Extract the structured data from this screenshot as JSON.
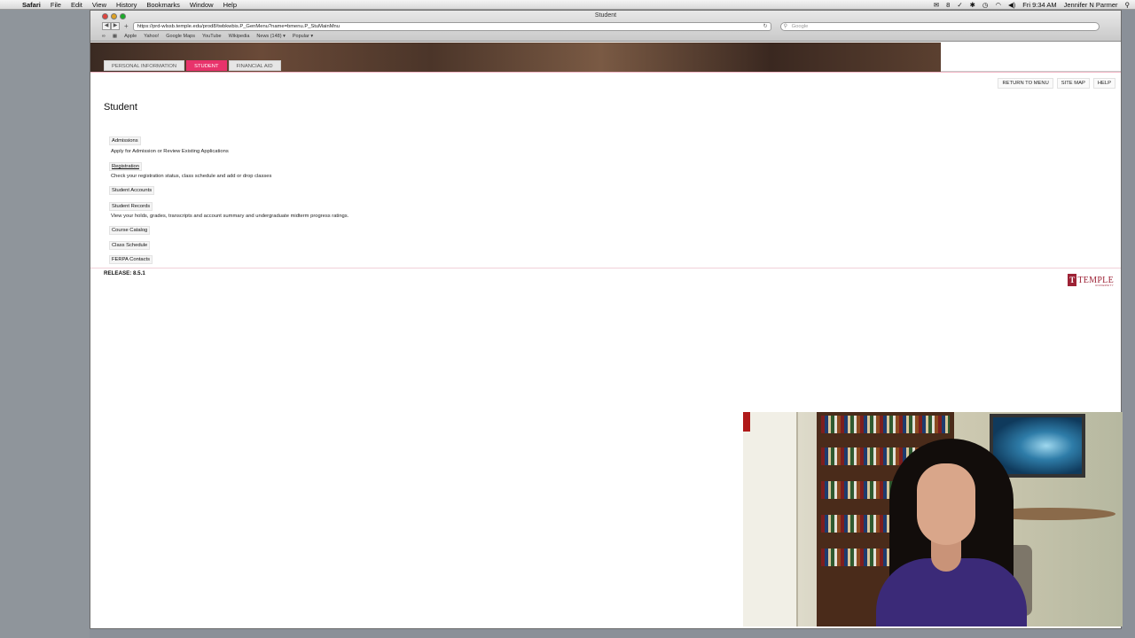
{
  "menubar": {
    "app": "Safari",
    "items": [
      "File",
      "Edit",
      "View",
      "History",
      "Bookmarks",
      "Window",
      "Help"
    ],
    "status": {
      "clock": "Fri 9:34 AM",
      "user": "Jennifer N Parmer",
      "badge": "8"
    }
  },
  "browser": {
    "window_title": "Student",
    "url": "https://prd-wlssb.temple.edu/prod8/twbkwbis.P_GenMenu?name=bmenu.P_StuMainMnu",
    "search_placeholder": "Google",
    "bookmarks": [
      "Apple",
      "Yahoo!",
      "Google Maps",
      "YouTube",
      "Wikipedia",
      "News (148) ▾",
      "Popular ▾"
    ]
  },
  "tabs": [
    {
      "label": "PERSONAL INFORMATION",
      "active": false
    },
    {
      "label": "STUDENT",
      "active": true
    },
    {
      "label": "FINANCIAL AID",
      "active": false
    }
  ],
  "topnav": [
    "RETURN TO MENU",
    "SITE MAP",
    "HELP"
  ],
  "page": {
    "title": "Student",
    "menu": [
      {
        "label": "Admissions",
        "desc": "Apply for Admission or Review Existing Applications"
      },
      {
        "label": "Registration",
        "desc": "Check your registration status, class schedule and add or drop classes"
      },
      {
        "label": "Student Accounts",
        "desc": ""
      },
      {
        "label": "Student Records",
        "desc": "View your holds, grades, transcripts and account summary and undergraduate midterm progress ratings."
      },
      {
        "label": "Course Catalog",
        "desc": ""
      },
      {
        "label": "Class Schedule",
        "desc": ""
      },
      {
        "label": "FERPA Contacts",
        "desc": ""
      }
    ],
    "release": "RELEASE: 8.5.1",
    "logo": {
      "mark": "T",
      "word": "TEMPLE",
      "sub": "UNIVERSITY"
    }
  },
  "colors": {
    "active_tab": "#e8336b",
    "temple_red": "#9d2235"
  }
}
